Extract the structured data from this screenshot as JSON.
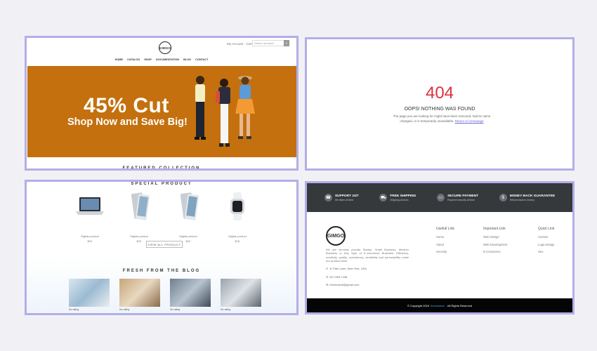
{
  "shop": {
    "logo": "GIMGO",
    "top_links": [
      "My Account",
      "Cart"
    ],
    "search_placeholder": "Search product...",
    "nav": [
      "HOME",
      "CATALOG",
      "SHOP",
      "DOCUMENTATION",
      "BLOG",
      "CONTACT"
    ],
    "banner": {
      "headline": "45% Cut",
      "subline": "Shop Now and Save Big!",
      "background": "#c4700e"
    },
    "featured_title": "FEATURED COLLECTION"
  },
  "not_found": {
    "code": "404",
    "title": "OOPS! NOTHING WAS FOUND",
    "message": "The page you are looking for might have been removed, had its name changed, or is temporarily unavailable.",
    "link_text": "Return to homepage",
    "code_color": "#d9333f"
  },
  "catalog": {
    "special_title": "SPECIAL PRODUCT",
    "products": [
      {
        "name": "Digital product",
        "price": "$22",
        "icon": "laptop-icon"
      },
      {
        "name": "Digital product",
        "price": "$22",
        "icon": "phone-icon"
      },
      {
        "name": "Digital product",
        "price": "$22",
        "icon": "phone-icon"
      },
      {
        "name": "Digital product",
        "price": "$15",
        "icon": "watch-icon"
      }
    ],
    "view_all": "VIEW ALL PRODUCT",
    "blog_title": "FRESH FROM THE BLOG",
    "blog_posts": [
      {
        "meta": "No rating"
      },
      {
        "meta": "No rating"
      },
      {
        "meta": "No rating"
      },
      {
        "meta": "No rating"
      }
    ]
  },
  "footer": {
    "features": [
      {
        "title": "SUPPORT 24/7",
        "sub": "We listen all time",
        "icon": "headset-icon"
      },
      {
        "title": "FREE SHIPPING",
        "sub": "Shipping all area",
        "icon": "truck-icon"
      },
      {
        "title": "SECURE PAYMENT",
        "sub": "Payment security all time",
        "icon": "card-icon"
      },
      {
        "title": "MONEY BACK GUARANTEE",
        "sub": "Refund back to money",
        "icon": "money-icon"
      }
    ],
    "logo": "GIMGO",
    "about": "We are services provide Startup, Small Business, Medium Business or Any Type of E-commerce Business. Efficiency, creativity, quality, consistency, sensitivity and personability make our product fame.",
    "address": "11 Park Lane, New York, USA",
    "phone": "617-555-7438",
    "email": "themeskart@gmail.com",
    "columns": [
      {
        "title": "Usefull Link",
        "items": [
          "Home",
          "About",
          "Security"
        ]
      },
      {
        "title": "Important Link",
        "items": [
          "Web Design",
          "Web Development",
          "E-Commerce"
        ]
      },
      {
        "title": "Quick Link",
        "items": [
          "Custom",
          "Logo Design",
          "Seo"
        ]
      }
    ],
    "copyright_pre": "© Copyright 2024",
    "copyright_brand": "themeskart",
    "copyright_post": ". All Rights Reserved"
  }
}
